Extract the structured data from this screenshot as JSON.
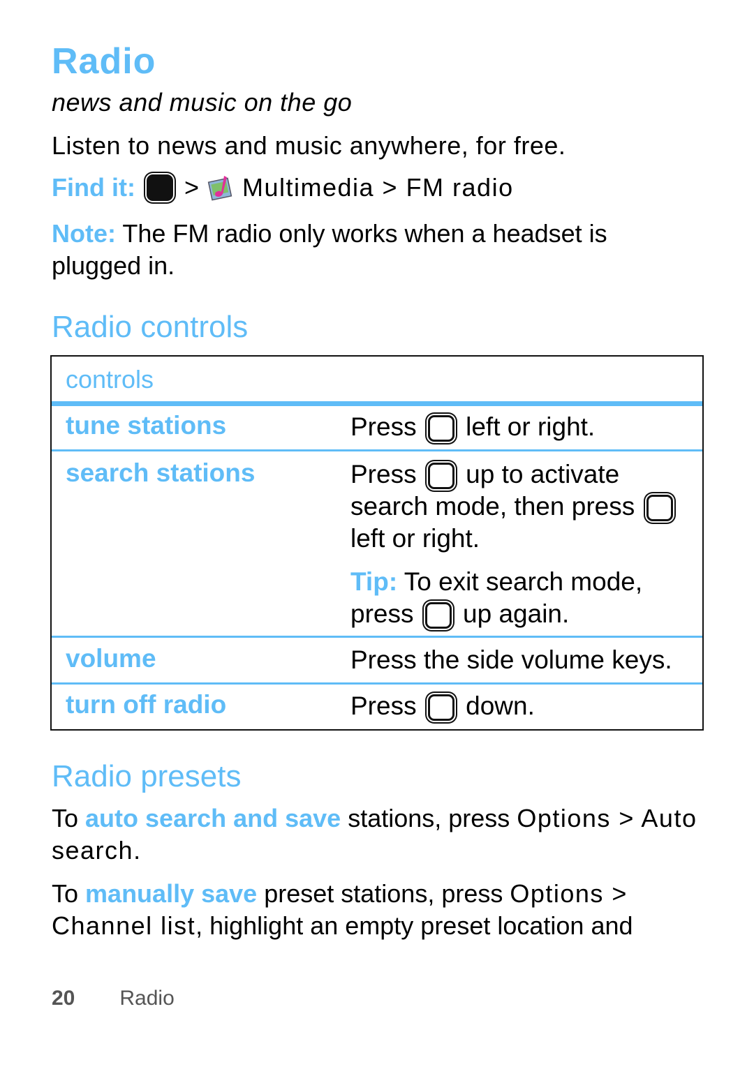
{
  "page": {
    "title": "Radio",
    "subtitle": "news and music on the go",
    "intro": "Listen to news and music anywhere, for free.",
    "find_it": {
      "label": "Find it:",
      "icons": [
        "menu-key-icon",
        "multimedia-icon"
      ],
      "separator": ">",
      "path_after_icon": "Multimedia > FM radio"
    },
    "note": {
      "label": "Note:",
      "text": " The FM radio only works when a headset is plugged in."
    }
  },
  "radio_controls": {
    "heading": "Radio controls",
    "table_header": "controls",
    "rows": [
      {
        "name": "tune stations",
        "desc_before": "Press ",
        "desc_after": " left or right."
      },
      {
        "name": "search stations",
        "desc_before": "Press ",
        "desc_mid": " up to activate search mode, then press ",
        "desc_after": " left or right.",
        "tip_label": "Tip:",
        "tip_before": " To exit search mode, press ",
        "tip_after": " up again."
      },
      {
        "name": "volume",
        "desc": "Press the side volume keys."
      },
      {
        "name": "turn off radio",
        "desc_before": "Press ",
        "desc_after": " down."
      }
    ]
  },
  "radio_presets": {
    "heading": "Radio presets",
    "para1": {
      "before": "To ",
      "highlight": "auto search and save",
      "after": " stations, press ",
      "ui": "Options > Auto search",
      "end": "."
    },
    "para2": {
      "before": "To ",
      "highlight": "manually save",
      "after": " preset stations, press ",
      "ui": "Options > Channel list",
      "end": ", highlight an empty preset location and"
    }
  },
  "footer": {
    "page_number": "20",
    "section": "Radio"
  },
  "colors": {
    "accent": "#5fbcf7",
    "text": "#000000"
  }
}
